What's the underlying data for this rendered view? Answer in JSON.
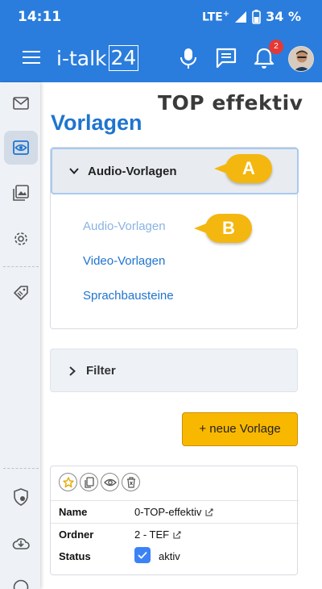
{
  "status_bar": {
    "time": "14:11",
    "network": "LTE",
    "network_plus": "+",
    "battery": "34 %"
  },
  "app_bar": {
    "logo_text": "i-talk",
    "logo_number": "24",
    "notification_count": "2"
  },
  "brand": "TOP effektiv",
  "page_title": "Vorlagen",
  "accordion": {
    "header": "Audio-Vorlagen",
    "items": [
      "Audio-Vorlagen",
      "Video-Vorlagen",
      "Sprachbausteine"
    ]
  },
  "callouts": {
    "a": "A",
    "b": "B"
  },
  "filter_label": "Filter",
  "new_button": "+ neue Vorlage",
  "template_table": {
    "rows": [
      {
        "key": "Name",
        "value": "0-TOP-effektiv"
      },
      {
        "key": "Ordner",
        "value": "2 - TEF"
      },
      {
        "key": "Status",
        "value": "aktiv"
      }
    ]
  },
  "colors": {
    "primary": "#2a7ddd",
    "accent": "#f9b800",
    "link": "#1f74cf",
    "badge": "#e53935"
  },
  "icons": [
    "menu-icon",
    "mic-icon",
    "chat-icon",
    "bell-icon",
    "mail-icon",
    "eye-icon",
    "image-icon",
    "gear-icon",
    "tag-icon",
    "shield-icon",
    "cloud-download-icon",
    "help-icon",
    "star-icon",
    "copy-icon",
    "delete-icon",
    "edit-icon",
    "check-icon"
  ]
}
